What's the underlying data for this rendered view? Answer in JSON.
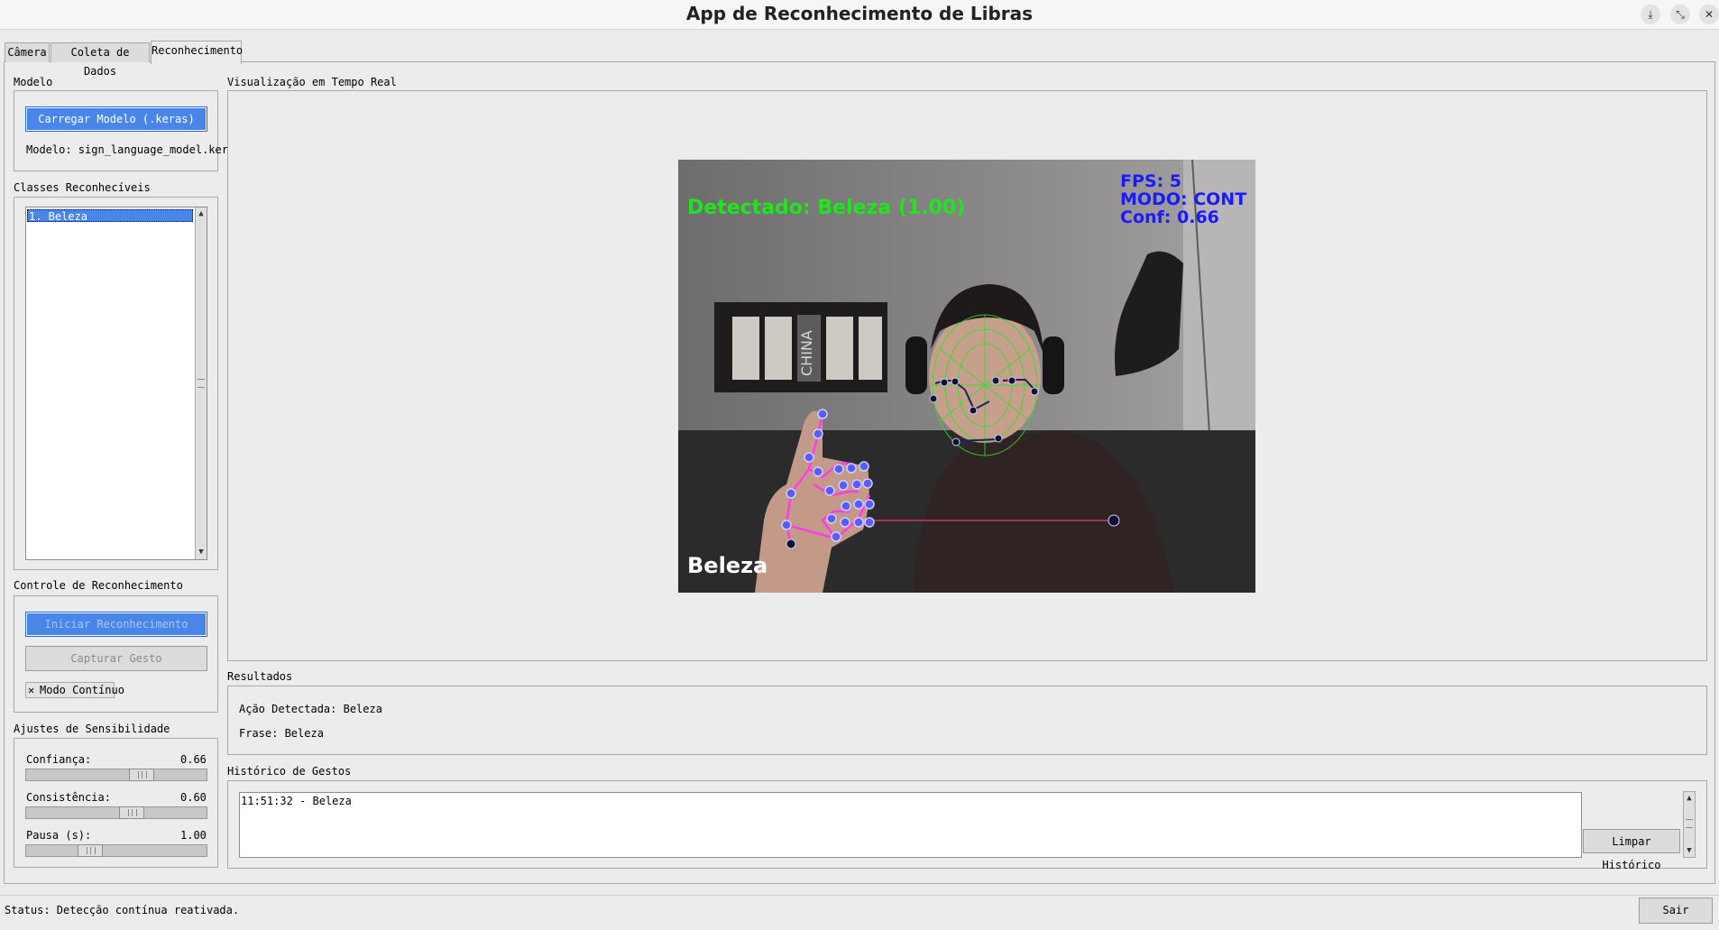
{
  "window": {
    "title": "App de Reconhecimento de Libras",
    "controls": {
      "download": "⤓",
      "restore": "⤡",
      "close": "✕"
    }
  },
  "tabs": [
    {
      "label": "Câmera",
      "active": false
    },
    {
      "label": "Coleta de Dados",
      "active": false
    },
    {
      "label": "Reconhecimento",
      "active": true
    }
  ],
  "model": {
    "group_label": "Modelo",
    "load_button": "Carregar Modelo (.keras)",
    "model_text": "Modelo: sign_language_model.keras"
  },
  "classes": {
    "group_label": "Classes Reconhecíveis",
    "items": [
      "1. Beleza"
    ]
  },
  "control": {
    "group_label": "Controle de Reconhecimento",
    "start_button": "Iniciar Reconhecimento",
    "capture_button": "Capturar Gesto",
    "continuous_mark": "✕",
    "continuous_label": "Modo Contínuo"
  },
  "sensitivity": {
    "group_label": "Ajustes de Sensibilidade",
    "sliders": [
      {
        "label": "Confiança:",
        "value": "0.66",
        "level": 0.66
      },
      {
        "label": "Consistência:",
        "value": "0.60",
        "level": 0.6
      },
      {
        "label": "Pausa (s):",
        "value": "1.00",
        "level": 0.33
      }
    ]
  },
  "visualization": {
    "group_label": "Visualização em Tempo Real",
    "overlay": {
      "detected": "Detectado: Beleza (1.00)",
      "fps": "FPS: 5",
      "mode": "MODO: CONT",
      "conf": "Conf: 0.66",
      "label": "Beleza",
      "poster_text": "CHINA"
    },
    "colors": {
      "detected": "#1ee61e",
      "stats": "#1a1aff",
      "hand_lines": "#ff3ce6",
      "hand_points": "#5a5aff",
      "mesh": "#32dc32"
    }
  },
  "results": {
    "group_label": "Resultados",
    "action": "Ação Detectada: Beleza",
    "phrase": "Frase: Beleza"
  },
  "history": {
    "group_label": "Histórico de Gestos",
    "entries": [
      "11:51:32 - Beleza"
    ],
    "clear_button": "Limpar Histórico"
  },
  "status": {
    "text": "Status: Detecção contínua reativada.",
    "exit_button": "Sair"
  }
}
